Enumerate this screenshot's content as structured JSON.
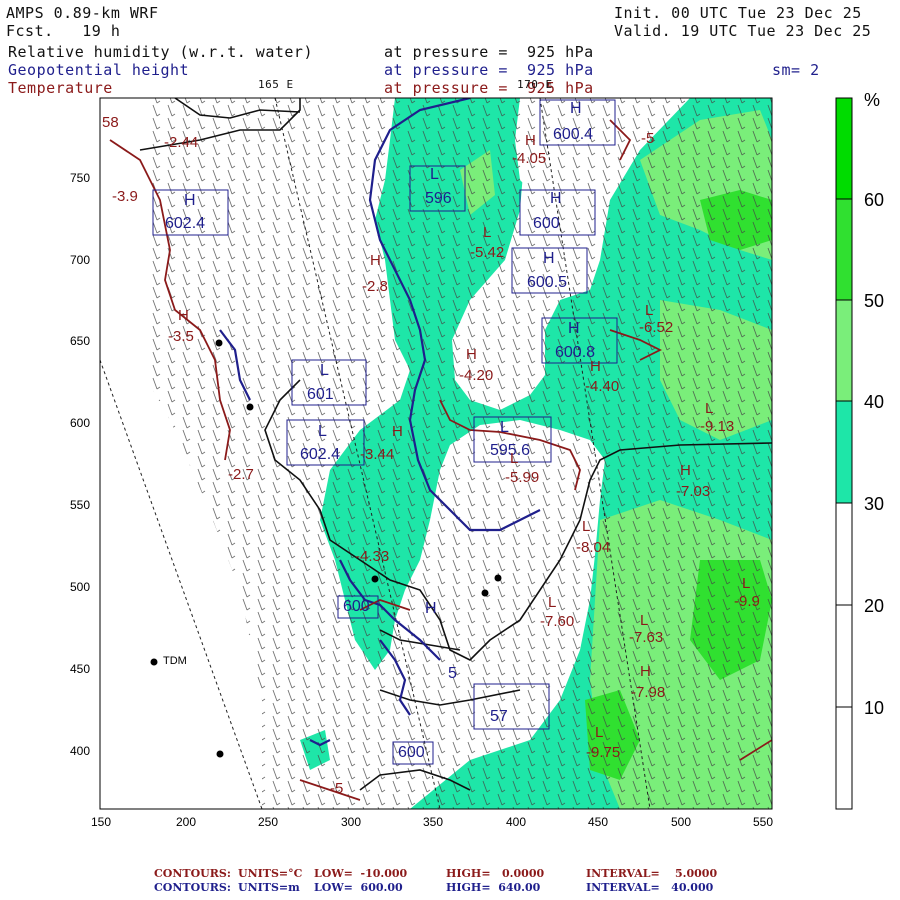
{
  "header": {
    "model": "AMPS 0.89-km WRF",
    "fcst": "Fcst.   19 h",
    "init": "Init. 00 UTC Tue 23 Dec 25",
    "valid": "Valid. 19 UTC Tue 23 Dec 25",
    "fields": [
      {
        "name": "Relative humidity (w.r.t. water)",
        "level": "at pressure =  925 hPa",
        "color": "#111111"
      },
      {
        "name": "Geopotential height",
        "level": "at pressure =  925 hPa",
        "color": "#1f1f8c"
      },
      {
        "name": "Temperature",
        "level": "at pressure =  925 hPa",
        "color": "#8b1a1a"
      }
    ],
    "smoothing": "sm= 2",
    "lon_labels": [
      "165 E",
      "170 E"
    ]
  },
  "map": {
    "x_ticks": [
      "150",
      "200",
      "250",
      "300",
      "350",
      "400",
      "450",
      "500",
      "550"
    ],
    "y_ticks": [
      "750",
      "700",
      "650",
      "600",
      "550",
      "500",
      "450",
      "400"
    ],
    "station_label": "TDM",
    "height_labels": [
      {
        "kind": "H",
        "value": "600.4"
      },
      {
        "kind": "L",
        "value": "596"
      },
      {
        "kind": "H",
        "value": "600"
      },
      {
        "kind": "H",
        "value": "600.5"
      },
      {
        "kind": "H",
        "value": "600.8"
      },
      {
        "kind": "L",
        "value": "601"
      },
      {
        "kind": "L",
        "value": "602.4"
      },
      {
        "kind": "L",
        "value": "595.6"
      },
      {
        "kind": "H",
        "value": "602.4"
      },
      {
        "kind": "",
        "value": "600"
      },
      {
        "kind": "",
        "value": "600"
      },
      {
        "kind": "",
        "value": "57"
      },
      {
        "kind": "H",
        "value": "5"
      }
    ],
    "temp_labels": [
      {
        "kind": "H",
        "value": "-4.05"
      },
      {
        "kind": "L",
        "value": "-5.42"
      },
      {
        "kind": "H",
        "value": "-2.8"
      },
      {
        "kind": "H",
        "value": "-4.20"
      },
      {
        "kind": "H",
        "value": "-3.44"
      },
      {
        "kind": "L",
        "value": "-5.99"
      },
      {
        "kind": "H",
        "value": "-4.40"
      },
      {
        "kind": "L",
        "value": "-6.52"
      },
      {
        "kind": "L",
        "value": "-9.13"
      },
      {
        "kind": "H",
        "value": "-7.03"
      },
      {
        "kind": "L",
        "value": "-8.04"
      },
      {
        "kind": "L",
        "value": "-7.60"
      },
      {
        "kind": "L",
        "value": "-7.63"
      },
      {
        "kind": "H",
        "value": "-7.98"
      },
      {
        "kind": "L",
        "value": "-9.75"
      },
      {
        "kind": "L",
        "value": "-9.9"
      },
      {
        "kind": "H",
        "value": "-3.5"
      },
      {
        "kind": "",
        "value": "-2.44"
      },
      {
        "kind": "",
        "value": "-3.9"
      },
      {
        "kind": "",
        "value": "-2.7"
      },
      {
        "kind": "",
        "value": "-4.33"
      },
      {
        "kind": "",
        "value": "-5"
      },
      {
        "kind": "",
        "value": "-5"
      },
      {
        "kind": "",
        "value": "58"
      }
    ]
  },
  "colorbar": {
    "unit": "%",
    "ticks": [
      "60",
      "50",
      "40",
      "30",
      "20",
      "10"
    ],
    "colors": [
      "#00dc00",
      "#30e030",
      "#7aee7a",
      "#1ee6a8",
      "#ffffff",
      "#ffffff",
      "#ffffff"
    ]
  },
  "footer": {
    "line1": {
      "label": "CONTOURS:",
      "units": "UNITS=°C",
      "low": "LOW=  -10.000",
      "high": "HIGH=   0.0000",
      "interval": "INTERVAL=    5.0000",
      "color": "#8b1a1a"
    },
    "line2": {
      "label": "CONTOURS:",
      "units": "UNITS=m",
      "low": "LOW=  600.00",
      "high": "HIGH=  640.00",
      "interval": "INTERVAL=   40.000",
      "color": "#1f1f8c"
    }
  }
}
